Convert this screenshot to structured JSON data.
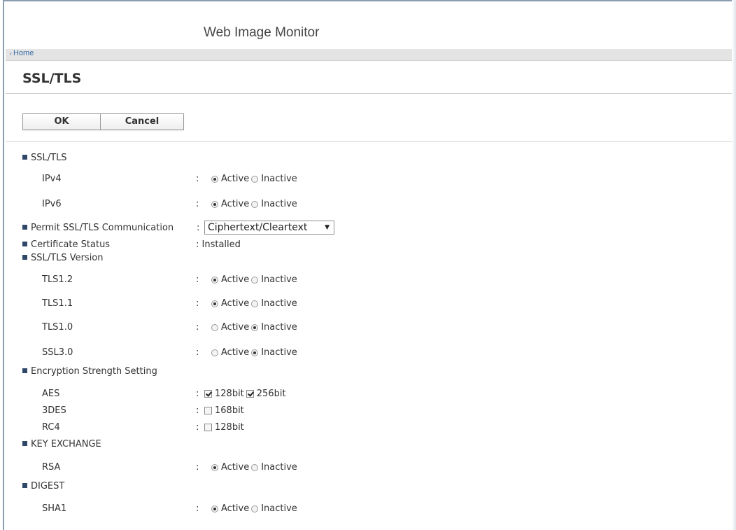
{
  "app": {
    "title": "Web Image Monitor"
  },
  "breadcrumb": {
    "home": "Home"
  },
  "page": {
    "title": "SSL/TLS"
  },
  "buttons": {
    "ok": "OK",
    "cancel": "Cancel"
  },
  "labels": {
    "active": "Active",
    "inactive": "Inactive",
    "colon": ":"
  },
  "sections": {
    "ssl_tls": {
      "title": "SSL/TLS",
      "ipv4": {
        "label": "IPv4",
        "value": "Active"
      },
      "ipv6": {
        "label": "IPv6",
        "value": "Active"
      }
    },
    "permit": {
      "title": "Permit SSL/TLS Communication",
      "selected": "Ciphertext/Cleartext"
    },
    "cert": {
      "title": "Certificate Status",
      "value": ": Installed"
    },
    "version": {
      "title": "SSL/TLS Version",
      "tls12": {
        "label": "TLS1.2",
        "value": "Active"
      },
      "tls11": {
        "label": "TLS1.1",
        "value": "Active"
      },
      "tls10": {
        "label": "TLS1.0",
        "value": "Inactive"
      },
      "ssl30": {
        "label": "SSL3.0",
        "value": "Inactive"
      }
    },
    "encryption": {
      "title": "Encryption Strength Setting",
      "aes": {
        "label": "AES",
        "opt1": "128bit",
        "opt1_checked": true,
        "opt2": "256bit",
        "opt2_checked": true
      },
      "des3": {
        "label": "3DES",
        "opt1": "168bit",
        "opt1_checked": false
      },
      "rc4": {
        "label": "RC4",
        "opt1": "128bit",
        "opt1_checked": false
      }
    },
    "key_exchange": {
      "title": "KEY EXCHANGE",
      "rsa": {
        "label": "RSA",
        "value": "Active"
      }
    },
    "digest": {
      "title": "DIGEST",
      "sha1": {
        "label": "SHA1",
        "value": "Active"
      }
    }
  },
  "colors": {
    "bullet": "#2f4868",
    "link": "#3a6ea5",
    "crumb_bg": "#e4e4e4"
  }
}
